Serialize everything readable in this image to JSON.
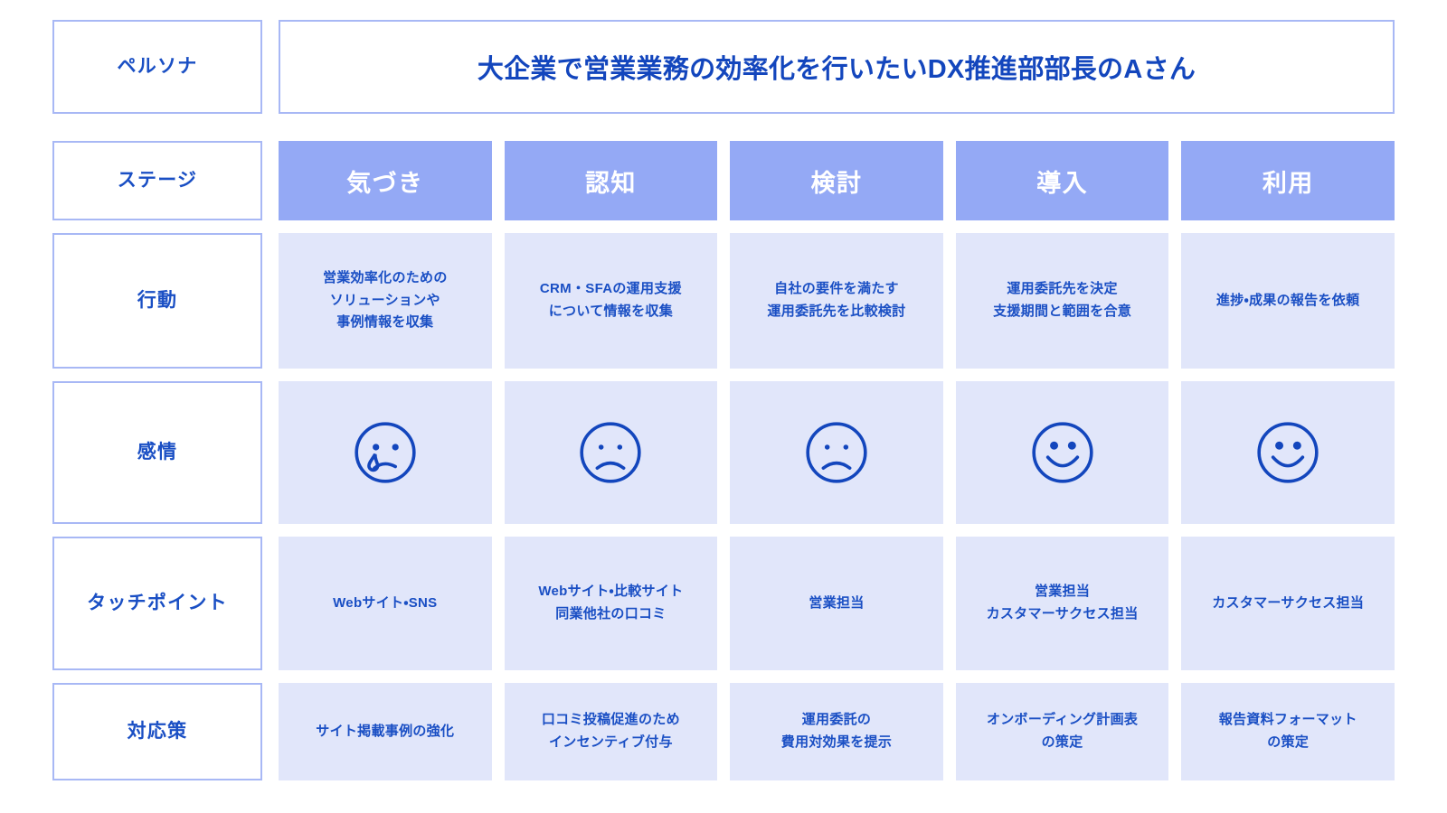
{
  "persona": {
    "row_label": "ペルソナ",
    "title": "大企業で営業業務の効率化を行いたいDX推進部部長のAさん"
  },
  "colors": {
    "accent_text": "#1346bd",
    "stage_fill": "#94a9f5",
    "cell_fill": "#e1e6fa",
    "border": "#a8b8f5",
    "background": "#ffffff"
  },
  "row_labels": {
    "stage": "ステージ",
    "action": "行動",
    "emotion": "感情",
    "touchpoint": "タッチポイント",
    "measure": "対応策"
  },
  "stages": [
    {
      "label": "気づき"
    },
    {
      "label": "認知"
    },
    {
      "label": "検討"
    },
    {
      "label": "導入"
    },
    {
      "label": "利用"
    }
  ],
  "rows": {
    "action": [
      "営業効率化のための\nソリューションや\n事例情報を収集",
      "CRM・SFAの運用支援\nについて情報を収集",
      "自社の要件を満たす\n運用委託先を比較検討",
      "運用委託先を決定\n支援期間と範囲を合意",
      "進捗・成果の報告を依頼"
    ],
    "emotion": [
      {
        "icon": "crying-face-icon",
        "mood": "crying"
      },
      {
        "icon": "sad-face-icon",
        "mood": "sad"
      },
      {
        "icon": "sad-face-icon",
        "mood": "sad"
      },
      {
        "icon": "smiling-face-icon",
        "mood": "happy"
      },
      {
        "icon": "smiling-face-icon",
        "mood": "happy"
      }
    ],
    "touchpoint": [
      "Webサイト・SNS",
      "Webサイト・比較サイト\n同業他社の口コミ",
      "営業担当",
      "営業担当\nカスタマーサクセス担当",
      "カスタマーサクセス担当"
    ],
    "measure": [
      "サイト掲載事例の強化",
      "口コミ投稿促進のため\nインセンティブ付与",
      "運用委託の\n費用対効果を提示",
      "オンボーディング計画表\nの策定",
      "報告資料フォーマット\nの策定"
    ]
  }
}
